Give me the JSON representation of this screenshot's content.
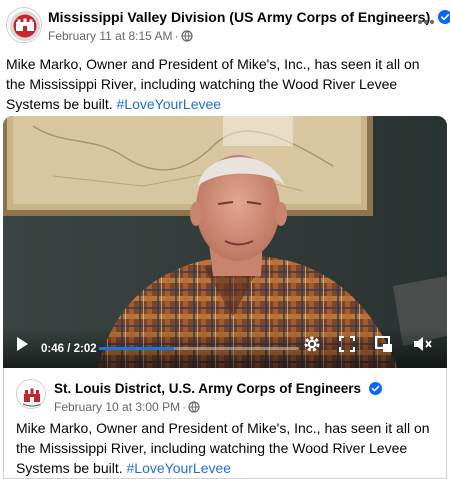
{
  "post": {
    "author": "Mississippi Valley Division (US Army Corps of Engineers)",
    "timestamp": "February 11 at 8:15 AM",
    "separator": "·",
    "text": "Mike Marko, Owner and President of Mike's, Inc., has seen it all on the Mississippi River, including watching the Wood River Levee Systems be built.",
    "hashtag": "#LoveYourLevee",
    "more_icon": "more-horizontal-icon",
    "verified_color": "#0866ff",
    "link_color": "#216fdb"
  },
  "video": {
    "current_time": "0:46",
    "time_separator": " / ",
    "duration": "2:02",
    "progress_fraction": 0.377,
    "icons": [
      "play-icon",
      "settings-icon",
      "fullscreen-icon",
      "picture-in-picture-icon",
      "volume-mute-icon"
    ]
  },
  "shared": {
    "author": "St. Louis District, U.S. Army Corps of Engineers",
    "timestamp": "February 10 at 3:00 PM",
    "separator": "·",
    "text": "Mike Marko, Owner and President of Mike's, Inc., has seen it all on the Mississippi River, including watching the Wood River Levee Systems be built.",
    "hashtag": "#LoveYourLevee"
  }
}
